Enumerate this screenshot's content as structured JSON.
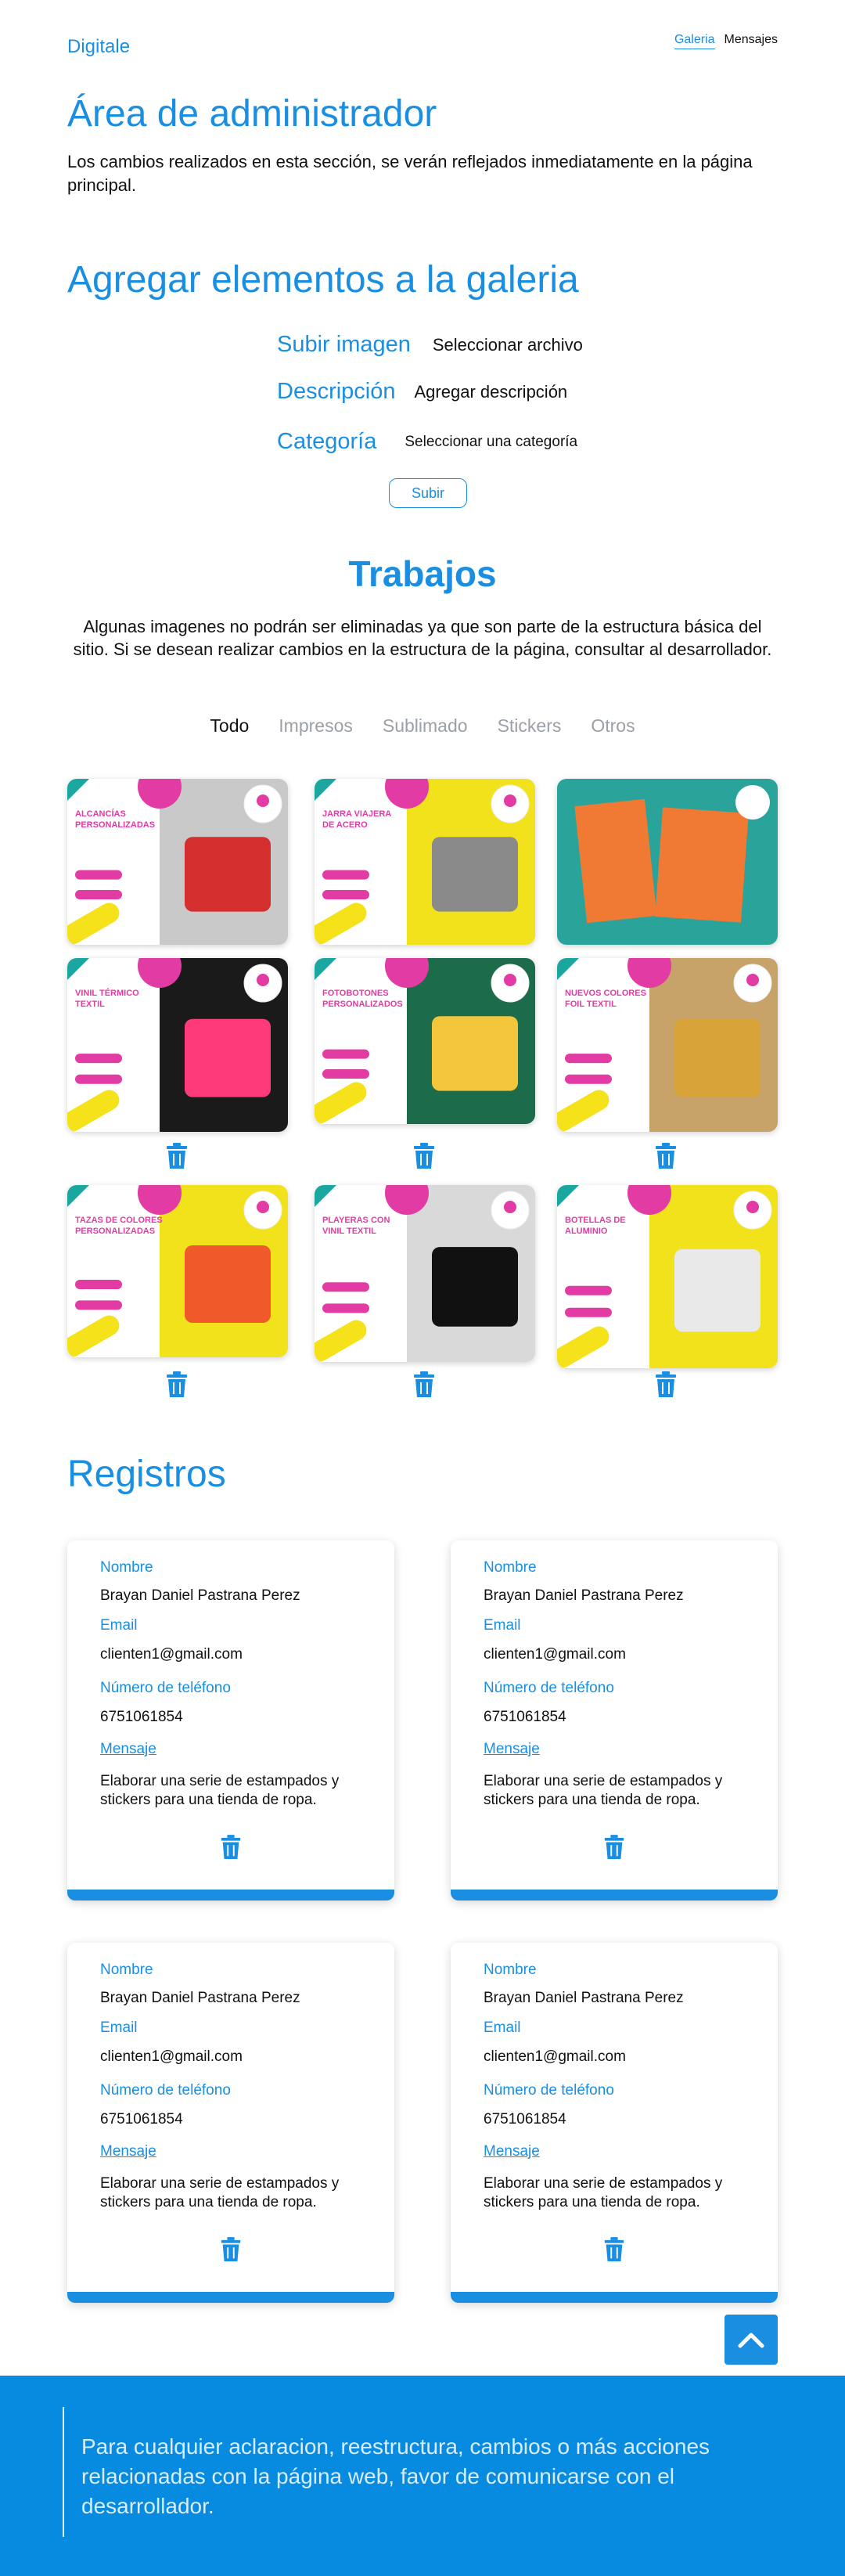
{
  "header": {
    "brand": "Digitale",
    "nav": [
      "Galeria",
      "Mensajes"
    ]
  },
  "admin": {
    "title": "Área de administrador",
    "description": "Los cambios realizados en esta sección, se verán reflejados inmediatamente en la página principal."
  },
  "form": {
    "title": "Agregar elementos a la galeria",
    "upload_label": "Subir imagen",
    "upload_value": "Seleccionar archivo",
    "desc_label": "Descripción",
    "desc_placeholder": "Agregar descripción",
    "category_label": "Categoría",
    "category_value": "Seleccionar una categoría",
    "submit": "Subir"
  },
  "works": {
    "title": "Trabajos",
    "note": "Algunas imagenes no podrán ser eliminadas ya que  son parte de la estructura básica del sitio. Si se desean realizar cambios en la estructura de la página, consultar al desarrollador.",
    "filters": [
      "Todo",
      "Impresos",
      "Sublimado",
      "Stickers",
      "Otros"
    ]
  },
  "gallery": [
    {
      "title1": "ALCANCÍAS",
      "title2": "PERSONALIZADAS",
      "accent": "#e23ba3",
      "photo": "#c9c9c9",
      "product": "#d42e2e"
    },
    {
      "title1": "JARRA VIAJERA",
      "title2": "DE ACERO",
      "accent": "#e23ba3",
      "photo": "#f2e21b",
      "product": "#8a8a8a"
    },
    {
      "title1": "",
      "title2": "",
      "accent": "#1aa7a0",
      "photo": "#2aa39a",
      "product": "#f07a34"
    },
    {
      "title1": "VINIL TÉRMICO",
      "title2": "TEXTIL",
      "accent": "#e23ba3",
      "photo": "#1a1a1a",
      "product": "#ff3a7a"
    },
    {
      "title1": "FOTOBOTONES",
      "title2": "PERSONALIZADOS",
      "accent": "#e23ba3",
      "photo": "#1c6b4a",
      "product": "#f2c53a"
    },
    {
      "title1": "NUEVOS COLORES",
      "title2": "FOIL TEXTIL",
      "accent": "#e23ba3",
      "photo": "#c7a36a",
      "product": "#d8a43a"
    },
    {
      "title1": "TAZAS DE COLORES",
      "title2": "PERSONALIZADAS",
      "accent": "#e23ba3",
      "photo": "#f2e21b",
      "product": "#f05a2a"
    },
    {
      "title1": "PLAYERAS CON",
      "title2": "VINIL TEXTIL",
      "accent": "#e23ba3",
      "photo": "#d9d9d9",
      "product": "#111111"
    },
    {
      "title1": "BOTELLAS DE",
      "title2": "ALUMINIO",
      "accent": "#e23ba3",
      "photo": "#f2e21b",
      "product": "#e9e9e9"
    }
  ],
  "records": {
    "title": "Registros",
    "labels": {
      "name": "Nombre",
      "email": "Email",
      "phone": "Número de teléfono",
      "message": "Mensaje"
    },
    "items": [
      {
        "name": "Brayan Daniel Pastrana Perez",
        "email": "clienten1@gmail.com",
        "phone": "6751061854",
        "message": "Elaborar una serie de estampados y stickers para una tienda de ropa."
      },
      {
        "name": "Brayan Daniel Pastrana Perez",
        "email": "clienten1@gmail.com",
        "phone": "6751061854",
        "message": "Elaborar una serie de estampados y stickers para una tienda de ropa."
      },
      {
        "name": "Brayan Daniel Pastrana Perez",
        "email": "clienten1@gmail.com",
        "phone": "6751061854",
        "message": "Elaborar una serie de estampados y stickers para una tienda de ropa."
      },
      {
        "name": "Brayan Daniel Pastrana Perez",
        "email": "clienten1@gmail.com",
        "phone": "6751061854",
        "message": "Elaborar una serie de estampados y stickers para una tienda de ropa."
      }
    ]
  },
  "footer": {
    "text": "Para cualquier aclaracion, reestructura, cambios o más acciones relacionadas con la página web, favor de comunicarse con el desarrollador."
  },
  "colors": {
    "primary": "#1a8ee0",
    "footer": "#078be0"
  }
}
